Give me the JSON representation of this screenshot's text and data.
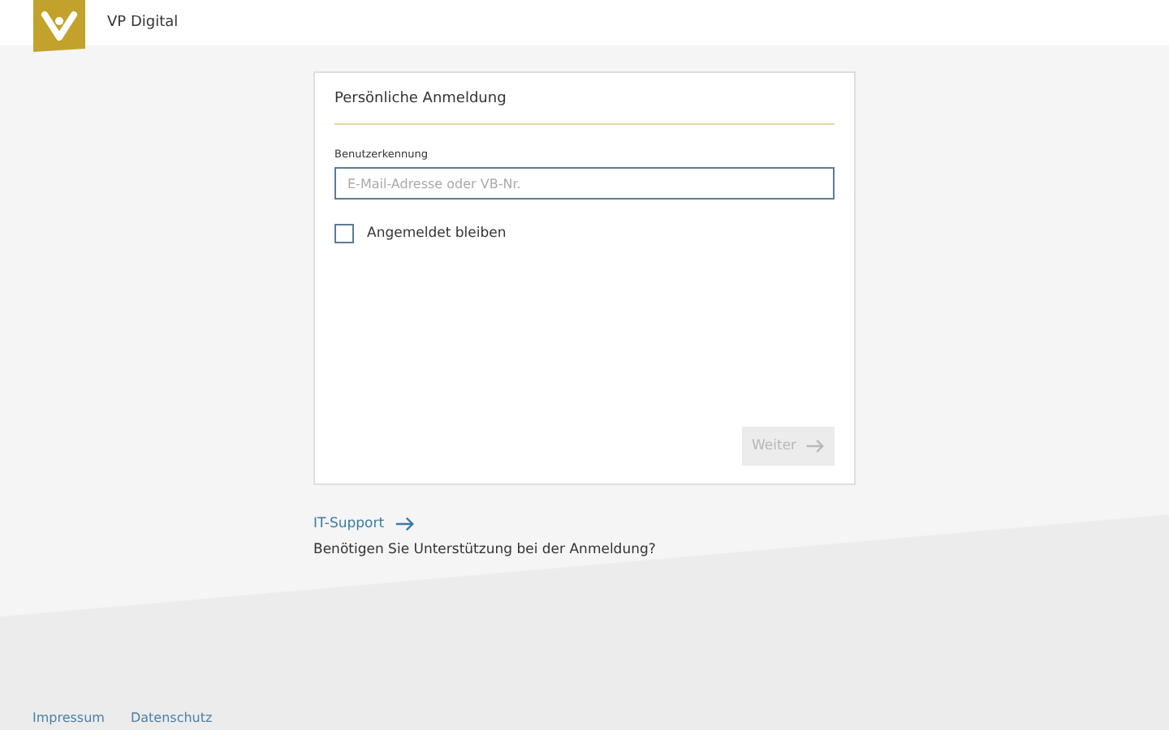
{
  "header": {
    "brand": "VP Digital"
  },
  "login_card": {
    "title": "Persönliche Anmeldung",
    "field_label": "Benutzerkennung",
    "placeholder": "E-Mail-Adresse oder VB-Nr.",
    "remember": {
      "label": "Angemeldet bleiben",
      "checked": false
    },
    "submit": {
      "label": "Weiter",
      "disabled": true
    }
  },
  "support": {
    "link": "IT-Support",
    "text": "Benötigen Sie Unterstützung bei der Anmeldung?"
  },
  "footer": {
    "links": [
      "Impressum",
      "Datenschutz"
    ]
  }
}
